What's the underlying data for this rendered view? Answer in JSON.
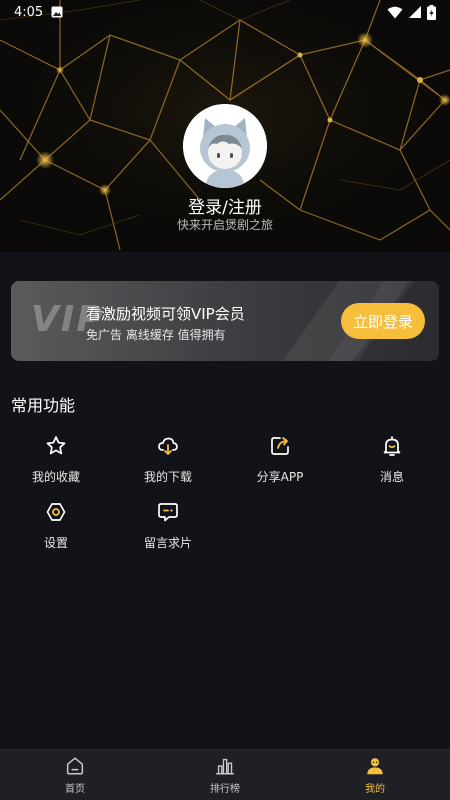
{
  "status_bar": {
    "time": "4:05"
  },
  "header": {
    "login_title": "登录/注册",
    "login_subtitle": "快来开启煲剧之旅"
  },
  "vip_card": {
    "watermark": "VIP",
    "title": "看激励视频可领VIP会员",
    "description": "免广告 离线缓存 值得拥有",
    "button_label": "立即登录"
  },
  "functions": {
    "section_title": "常用功能",
    "items": [
      {
        "label": "我的收藏",
        "icon": "star-icon"
      },
      {
        "label": "我的下载",
        "icon": "cloud-download-icon"
      },
      {
        "label": "分享APP",
        "icon": "share-icon"
      },
      {
        "label": "消息",
        "icon": "bell-icon"
      },
      {
        "label": "设置",
        "icon": "settings-icon"
      },
      {
        "label": "留言求片",
        "icon": "message-icon"
      }
    ]
  },
  "bottom_nav": {
    "items": [
      {
        "label": "首页",
        "icon": "home-icon",
        "active": false
      },
      {
        "label": "排行榜",
        "icon": "ranking-icon",
        "active": false
      },
      {
        "label": "我的",
        "icon": "user-icon",
        "active": true
      }
    ]
  },
  "colors": {
    "accent": "#f7be3c",
    "background": "#121318",
    "nav_background": "#1f2026"
  }
}
